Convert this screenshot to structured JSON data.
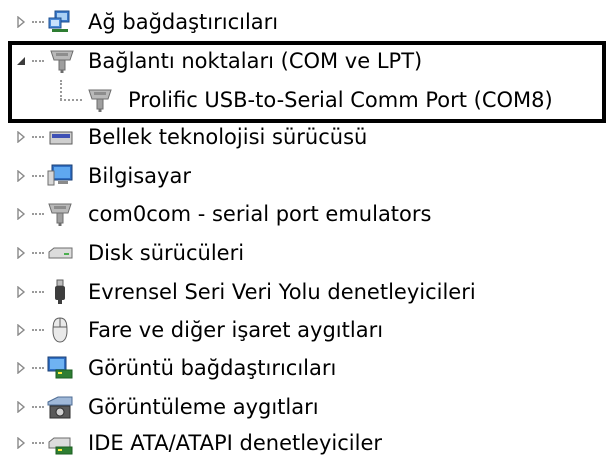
{
  "tree": {
    "nodes": [
      {
        "label": "Ağ bağdaştırıcıları",
        "icon": "network-adapter-icon",
        "expanded": false
      },
      {
        "label": "Bağlantı noktaları (COM ve LPT)",
        "icon": "port-connector-icon",
        "expanded": true
      },
      {
        "label": "Prolific USB-to-Serial Comm Port (COM8)",
        "icon": "port-connector-icon",
        "child": true
      },
      {
        "label": "Bellek teknolojisi sürücüsü",
        "icon": "memory-device-icon",
        "expanded": false
      },
      {
        "label": "Bilgisayar",
        "icon": "computer-icon",
        "expanded": false
      },
      {
        "label": "com0com - serial port emulators",
        "icon": "port-connector-icon",
        "expanded": false
      },
      {
        "label": "Disk sürücüleri",
        "icon": "disk-drive-icon",
        "expanded": false
      },
      {
        "label": "Evrensel Seri Veri Yolu denetleyicileri",
        "icon": "usb-plug-icon",
        "expanded": false
      },
      {
        "label": "Fare ve diğer işaret aygıtları",
        "icon": "mouse-icon",
        "expanded": false
      },
      {
        "label": "Görüntü bağdaştırıcıları",
        "icon": "display-adapter-icon",
        "expanded": false
      },
      {
        "label": "Görüntüleme aygıtları",
        "icon": "imaging-device-icon",
        "expanded": false
      },
      {
        "label": "IDE ATA/ATAPI denetleyiciler",
        "icon": "ide-controller-icon",
        "expanded": false
      }
    ]
  },
  "colors": {
    "highlight_border": "#000000",
    "tree_lines": "#9a9a9a",
    "text": "#000000"
  }
}
